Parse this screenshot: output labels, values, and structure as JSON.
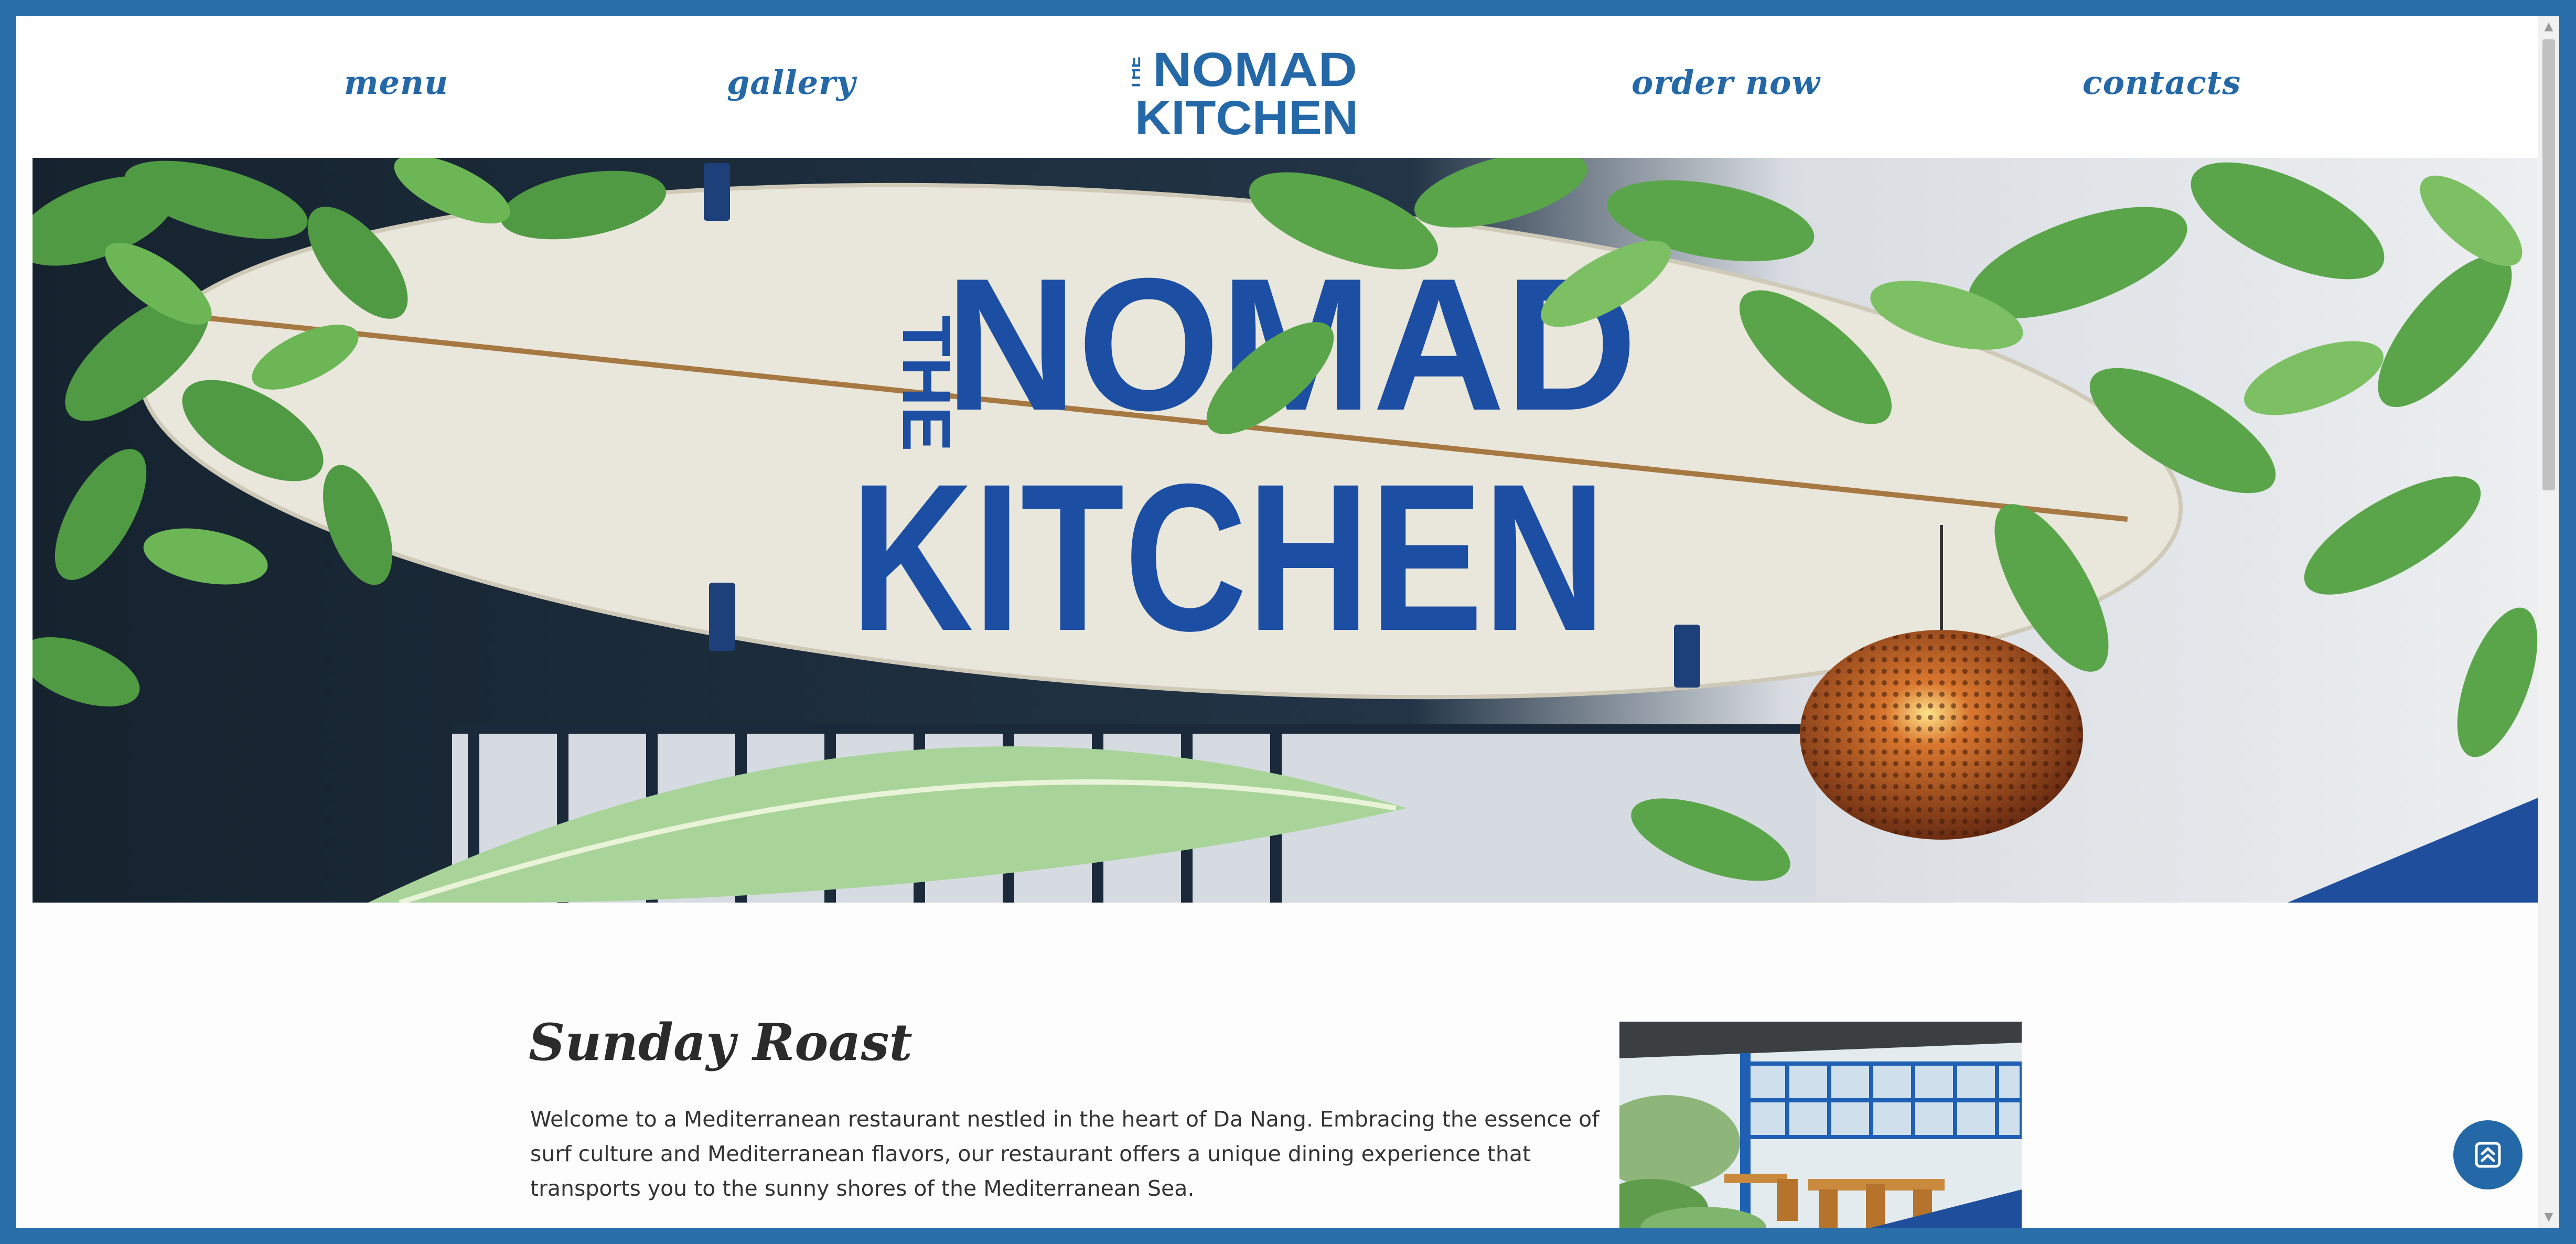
{
  "nav": {
    "menu": "menu",
    "gallery": "gallery",
    "order_now": "order now",
    "contacts": "contacts"
  },
  "logo": {
    "the": "THE",
    "nomad": "NOMAD",
    "kitchen": "KITCHEN"
  },
  "hero": {
    "sign_the": "THE",
    "sign_nomad": "NOMAD",
    "sign_kitchen": "KITCHEN"
  },
  "content": {
    "title": "Sunday Roast",
    "text": "Welcome to a Mediterranean restaurant nestled in the heart of Da Nang. Embracing the essence of surf culture and Mediterranean flavors, our restaurant offers a unique dining experience that transports you to the sunny shores of the Mediterranean Sea."
  },
  "icons": {
    "back_to_top": "chevrons-up-icon",
    "scroll_up": "triangle-up-icon",
    "scroll_down": "triangle-down-icon"
  },
  "colors": {
    "brand_blue": "#2468a8",
    "frame_blue": "#2a6faa",
    "heading_dark": "#2b2b2b",
    "body_text": "#333333"
  }
}
